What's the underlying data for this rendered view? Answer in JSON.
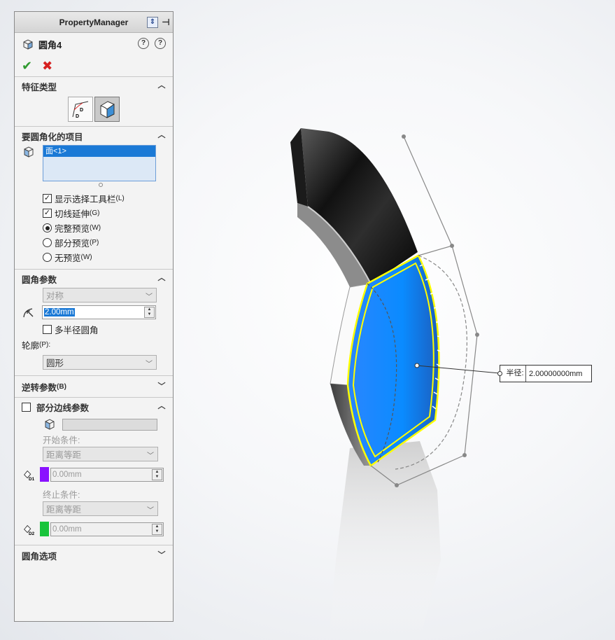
{
  "property_manager": {
    "header_title": "PropertyManager",
    "feature_title": "圆角4",
    "help_labels": [
      "?",
      "?"
    ],
    "sections": {
      "feature_type": {
        "title": "特征类型"
      },
      "items_to_fillet": {
        "title": "要圆角化的项目",
        "selection_list": [
          "面<1>"
        ],
        "show_toolbar_label": "显示选择工具栏",
        "show_toolbar_accel": "(L)",
        "show_toolbar_checked": true,
        "tangent_label": "切线延伸",
        "tangent_accel": "(G)",
        "tangent_checked": true,
        "preview_options": [
          {
            "label": "完整预览",
            "accel": "(W)",
            "selected": true
          },
          {
            "label": "部分预览",
            "accel": "(P)",
            "selected": false
          },
          {
            "label": "无预览",
            "accel": "(W)",
            "selected": false
          }
        ]
      },
      "fillet_params": {
        "title": "圆角参数",
        "method": "对称",
        "radius": "2.00mm",
        "multi_radius_label": "多半径圆角",
        "multi_radius_checked": false,
        "profile_label": "轮廓",
        "profile_accel": "(P):",
        "profile_value": "圆形"
      },
      "reverse_params": {
        "title": "逆转参数",
        "accel": "(B)"
      },
      "partial_edge": {
        "title": "部分边线参数",
        "checked": false,
        "start_condition_label": "开始条件:",
        "start_condition_value": "距离等距",
        "start_value": "0.00mm",
        "start_color": "#8a12ff",
        "end_condition_label": "终止条件:",
        "end_condition_value": "距离等距",
        "end_value": "0.00mm",
        "end_color": "#19c43c"
      },
      "fillet_options": {
        "title": "圆角选项"
      }
    }
  },
  "callout": {
    "label": "半径:",
    "value": "2.00000000mm"
  },
  "colors": {
    "selected_face": "#1a8cff",
    "highlight_edge": "#ffff00",
    "accent_selection": "#1a79d6"
  }
}
